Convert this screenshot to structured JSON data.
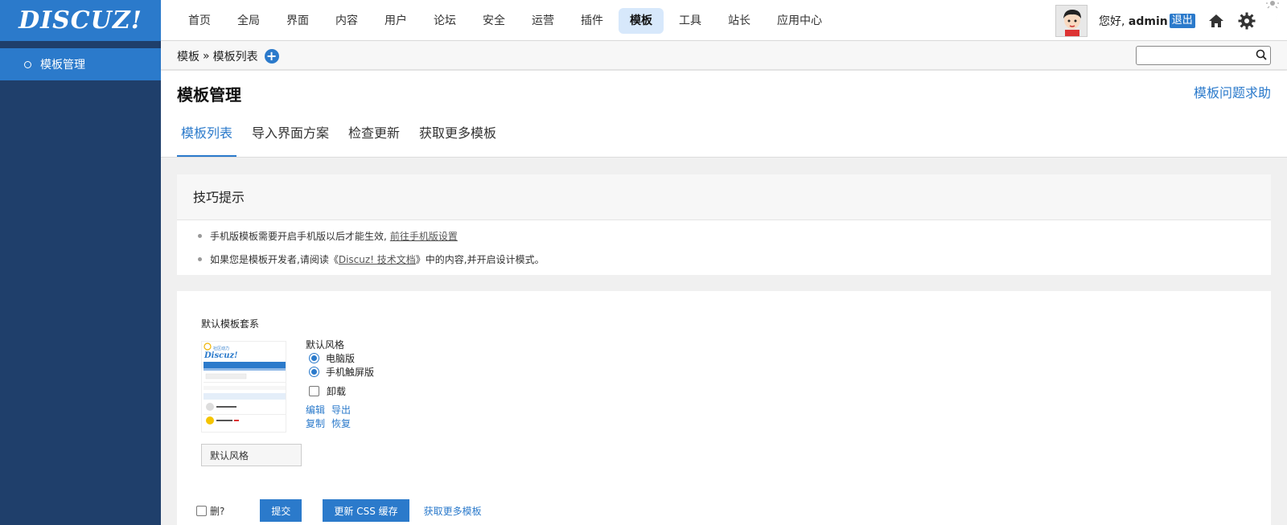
{
  "header": {
    "logo_text": "DISCUZ!",
    "nav": [
      "首页",
      "全局",
      "界面",
      "内容",
      "用户",
      "论坛",
      "安全",
      "运营",
      "插件",
      "模板",
      "工具",
      "站长",
      "应用中心"
    ],
    "active_nav": "模板",
    "greeting": "您好,",
    "username": "admin",
    "logout": "退出"
  },
  "sidebar": {
    "items": [
      {
        "label": "模板管理",
        "active": true
      }
    ]
  },
  "breadcrumb": {
    "root": "模板",
    "sep": "»",
    "current": "模板列表",
    "search_placeholder": ""
  },
  "page": {
    "title": "模板管理",
    "help_link": "模板问题求助",
    "tabs": [
      "模板列表",
      "导入界面方案",
      "检查更新",
      "获取更多模板"
    ],
    "active_tab": "模板列表"
  },
  "tips": {
    "title": "技巧提示",
    "line1_text": "手机版模板需要开启手机版以后才能生效,",
    "line1_link": "前往手机版设置",
    "line2_prefix": "如果您是模板开发者,请阅读《",
    "line2_link": "Discuz! 技术文档",
    "line2_suffix": "》中的内容,并开启设计模式。"
  },
  "template_set": {
    "title": "默认模板套系",
    "style_label": "默认风格",
    "option_pc": "电脑版",
    "option_mobile": "手机触屏版",
    "option_uninstall": "卸载",
    "link_edit": "编辑",
    "link_export": "导出",
    "link_copy": "复制",
    "link_restore": "恢复",
    "name_value": "默认风格",
    "thumb_logo": "Discuz!"
  },
  "footer": {
    "delete_label": "删?",
    "submit": "提交",
    "update_css": "更新 CSS 缓存",
    "more_link": "获取更多模板"
  },
  "colors": {
    "brand": "#2b7acb",
    "sidebar": "#1f3f6b",
    "active_nav_bg": "#d7e8fb"
  }
}
